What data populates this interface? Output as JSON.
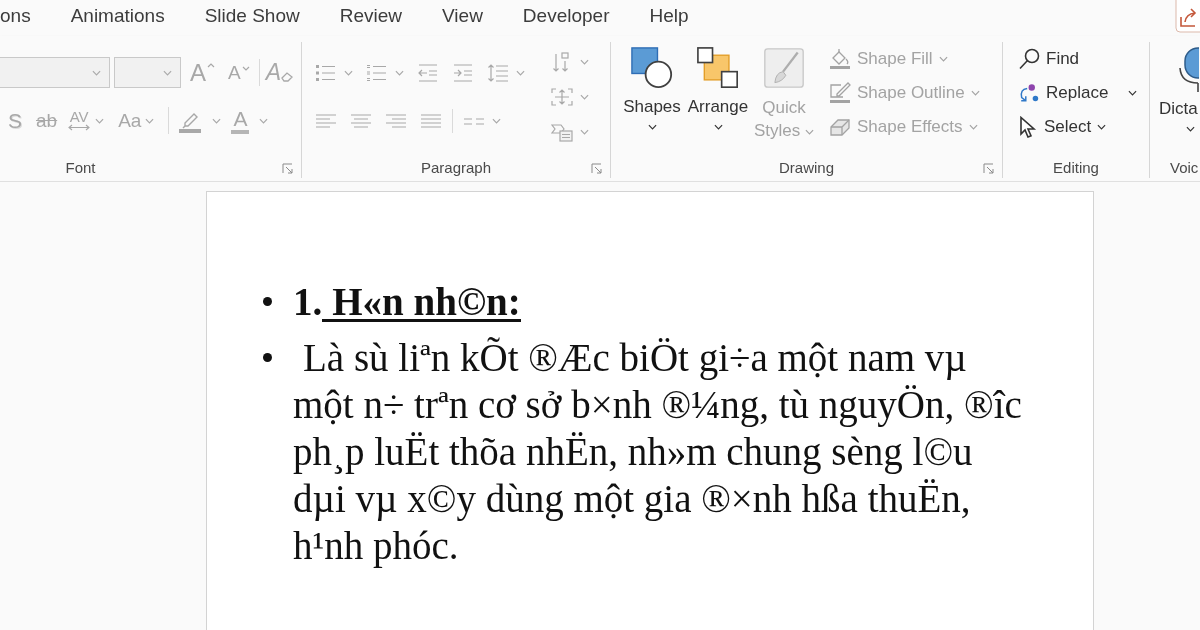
{
  "tabs": [
    {
      "label": "ons",
      "selected": false
    },
    {
      "label": "Animations",
      "selected": false
    },
    {
      "label": "Slide Show",
      "selected": false
    },
    {
      "label": "Review",
      "selected": false
    },
    {
      "label": "View",
      "selected": false
    },
    {
      "label": "Developer",
      "selected": false
    },
    {
      "label": "Help",
      "selected": false
    }
  ],
  "font_group": {
    "label": "Font",
    "launcher": true,
    "row_1": [
      {
        "kind": "namebox",
        "disabled": true
      },
      {
        "kind": "sizebox",
        "disabled": true
      },
      {
        "kind": "grow",
        "text": "A",
        "disabled": true
      },
      {
        "kind": "shrink",
        "text": "A",
        "disabled": true
      },
      {
        "kind": "clear",
        "text": "A",
        "disabled": true
      }
    ],
    "row_2": [
      {
        "kind": "shadow",
        "text": "S",
        "disabled": true
      },
      {
        "kind": "strike",
        "text": "ab",
        "disabled": true
      },
      {
        "kind": "spacing",
        "text": "AV",
        "disabled": true
      },
      {
        "kind": "case",
        "text": "Aa",
        "disabled": true
      },
      {
        "kind": "highlight",
        "disabled": true
      },
      {
        "kind": "color",
        "text": "A",
        "disabled": true
      }
    ]
  },
  "paragraph_group": {
    "label": "Paragraph",
    "launcher": true,
    "row_1": [
      {
        "kind": "bullets",
        "disabled": true
      },
      {
        "kind": "numbering",
        "disabled": true
      },
      {
        "kind": "outdent",
        "disabled": true
      },
      {
        "kind": "indent",
        "disabled": true
      },
      {
        "kind": "spacing",
        "disabled": true
      }
    ],
    "row_2": [
      {
        "kind": "left",
        "disabled": true
      },
      {
        "kind": "center",
        "disabled": true
      },
      {
        "kind": "right",
        "disabled": true
      },
      {
        "kind": "justify",
        "disabled": true
      },
      {
        "kind": "columns",
        "disabled": true
      }
    ],
    "side": [
      {
        "kind": "direction",
        "disabled": true
      },
      {
        "kind": "valign",
        "disabled": true
      },
      {
        "kind": "smartart",
        "disabled": true
      }
    ]
  },
  "drawing_group": {
    "label": "Drawing",
    "launcher": true,
    "big": [
      {
        "kind": "shapes",
        "label": "Shapes",
        "disabled": false
      },
      {
        "kind": "arrange",
        "label": "Arrange",
        "disabled": false
      },
      {
        "kind": "styles",
        "label": "Quick Styles",
        "disabled": true
      }
    ],
    "side": [
      {
        "kind": "fill",
        "label": "Shape Fill",
        "disabled": true
      },
      {
        "kind": "outline",
        "label": "Shape Outline",
        "disabled": true
      },
      {
        "kind": "effects",
        "label": "Shape Effects",
        "disabled": true
      }
    ]
  },
  "editing_group": {
    "label": "Editing",
    "launcher": false,
    "items": [
      {
        "kind": "find",
        "label": "Find"
      },
      {
        "kind": "replace",
        "label": "Replace"
      },
      {
        "kind": "select",
        "label": "Select"
      }
    ]
  },
  "voice_group": {
    "label": "Voic",
    "button": "Dicta"
  },
  "slide": {
    "items": [
      {
        "kind": "heading",
        "number": "1.",
        "title": "H«n nh©n:"
      },
      {
        "kind": "body",
        "text": "Là sù liªn kÕt ®Æc biÖt gi÷a một nam vµ một n÷ trªn cơ sở b×nh ®¼ng, tù nguyÖn, ®îc ph¸p luËt thõa nhËn, nh»m chung sèng l©u dµi vµ x©y dùng một gia ®×nh hßa thuËn, h¹nh phóc."
      }
    ]
  }
}
